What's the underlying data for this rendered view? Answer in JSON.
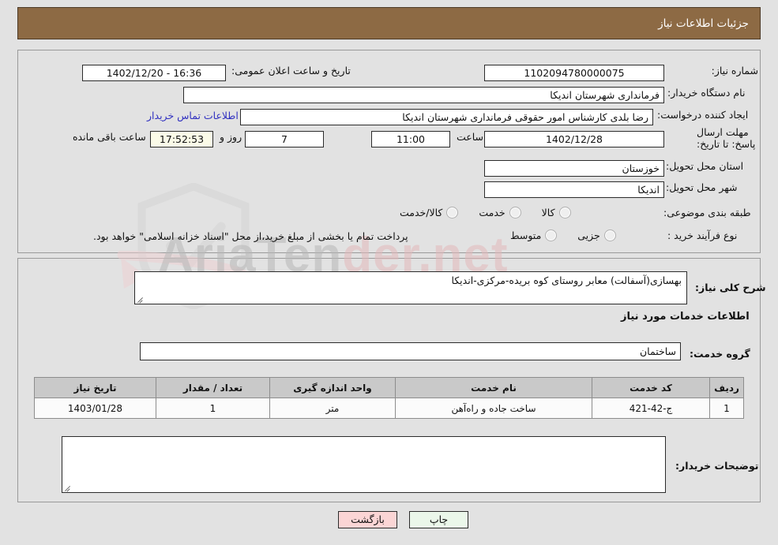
{
  "header": {
    "title": "جزئیات اطلاعات نیاز"
  },
  "form": {
    "need_number_label": "شماره نیاز:",
    "need_number_value": "1102094780000075",
    "announce_datetime_label": "تاریخ و ساعت اعلان عمومی:",
    "announce_datetime_value": "16:36 - 1402/12/20",
    "buyer_org_label": "نام دستگاه خریدار:",
    "buyer_org_value": "فرمانداری شهرستان اندیکا",
    "creator_label": "ایجاد کننده درخواست:",
    "creator_value": "رضا بلدی کارشناس امور حقوقی فرمانداری شهرستان اندیکا",
    "contact_link": "اطلاعات تماس خریدار",
    "deadline_label": "مهلت ارسال پاسخ: تا تاریخ:",
    "deadline_date": "1402/12/28",
    "hour_label": "ساعت",
    "hour_value": "11:00",
    "days_remaining": "7",
    "days_word": "روز و",
    "countdown": "17:52:53",
    "remaining_suffix": "ساعت باقی مانده",
    "province_label": "استان محل تحویل:",
    "province_value": "خوزستان",
    "city_label": "شهر محل تحویل:",
    "city_value": "اندیکا",
    "category_label": "طبقه بندی موضوعی:",
    "category_options": [
      {
        "label": "کالا",
        "checked": false
      },
      {
        "label": "خدمت",
        "checked": false
      },
      {
        "label": "کالا/خدمت",
        "checked": false
      }
    ],
    "process_label": "نوع فرآیند خرید :",
    "process_options": [
      {
        "label": "جزیی",
        "checked": false
      },
      {
        "label": "متوسط",
        "checked": false
      }
    ],
    "payment_note": "پرداخت تمام یا بخشی از مبلغ خرید،از محل \"اسناد خزانه اسلامی\" خواهد بود."
  },
  "need_summary": {
    "label": "شرح کلی نیاز:",
    "value": "بهسازی(آسفالت) معابر روستای کوه بریده-مرکزی-اندیکا"
  },
  "services_section": {
    "heading": "اطلاعات خدمات مورد نیاز",
    "group_label": "گروه خدمت:",
    "group_value": "ساختمان"
  },
  "table": {
    "columns": [
      "ردیف",
      "کد خدمت",
      "نام خدمت",
      "واحد اندازه گیری",
      "تعداد / مقدار",
      "تاریخ نیاز"
    ],
    "rows": [
      {
        "row_no": "1",
        "service_code": "ج-42-421",
        "service_name": "ساخت جاده و راه‌آهن",
        "unit": "متر",
        "quantity": "1",
        "need_date": "1403/01/28"
      }
    ]
  },
  "buyer_notes": {
    "label": "توضیحات خریدار:",
    "value": ""
  },
  "footer": {
    "back_label": "بازگشت",
    "print_label": "چاپ"
  },
  "watermark": {
    "text_left": "AriaTen",
    "text_right": "der.net"
  },
  "colors": {
    "header_bg": "#8d6a44",
    "page_bg": "#e2e2e2",
    "link": "#3030c0",
    "table_header_bg": "#c9c9c9",
    "back_btn_bg": "#fbd5d5",
    "print_btn_bg": "#ebf7ea",
    "countdown_bg": "#fbfbe8"
  }
}
